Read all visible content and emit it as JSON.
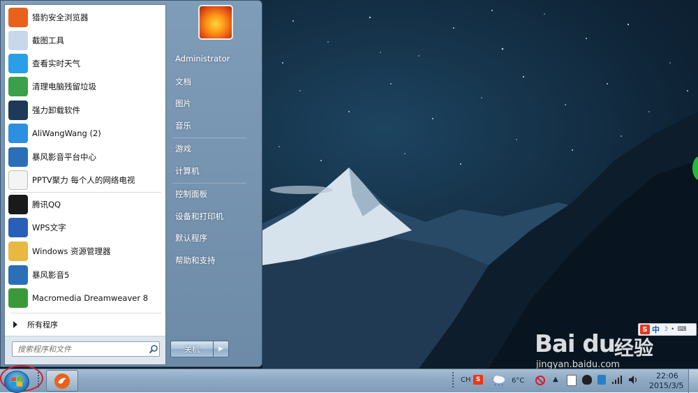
{
  "start_menu": {
    "programs": [
      {
        "label": "猎豹安全浏览器",
        "icon": "cheetah-browser-icon",
        "color": "#e8621a"
      },
      {
        "label": "截图工具",
        "icon": "scissors-icon",
        "color": "#c8d8ea"
      },
      {
        "label": "查看实时天气",
        "icon": "weather-cloud-icon",
        "color": "#2a9ee8"
      },
      {
        "label": "清理电脑残留垃圾",
        "icon": "recycle-bin-icon",
        "color": "#3aa04a"
      },
      {
        "label": "强力卸载软件",
        "icon": "uninstall-shield-icon",
        "color": "#1e3a58"
      },
      {
        "label": "AliWangWang (2)",
        "icon": "aliwangwang-icon",
        "color": "#2c8fe0"
      },
      {
        "label": "暴风影音平台中心",
        "icon": "film-icon",
        "color": "#2a6fb8"
      },
      {
        "label": "PPTV聚力 每个人的网络电视",
        "icon": "blank-file-icon",
        "color": "#f4f4f4"
      },
      {
        "label": "腾讯QQ",
        "icon": "qq-penguin-icon",
        "color": "#1a1a1a"
      },
      {
        "label": "WPS文字",
        "icon": "wps-writer-icon",
        "color": "#2a5fb8"
      },
      {
        "label": "Windows 资源管理器",
        "icon": "explorer-folder-icon",
        "color": "#e8b840"
      },
      {
        "label": "暴风影音5",
        "icon": "film-icon",
        "color": "#2a6fb8"
      },
      {
        "label": "Macromedia Dreamweaver 8",
        "icon": "dreamweaver-icon",
        "color": "#3a9a3a"
      }
    ],
    "all_programs": "所有程序",
    "search_placeholder": "搜索程序和文件",
    "right": {
      "user": "Administrator",
      "documents": "文档",
      "pictures": "图片",
      "music": "音乐",
      "games": "游戏",
      "computer": "计算机",
      "control_panel": "控制面板",
      "devices_printers": "设备和打印机",
      "default_programs": "默认程序",
      "help_support": "帮助和支持"
    },
    "shutdown_label": "关机"
  },
  "taskbar": {
    "ime_lang": "CH",
    "temperature": "6°C",
    "time": "22:06",
    "date": "2015/3/5"
  },
  "ime_bar": {
    "logo": "S",
    "mode": "中"
  },
  "watermark": {
    "logo": "Bai du",
    "cn": "经验",
    "url": "jingyan.baidu.com"
  },
  "colors": {
    "accent_red": "#d41e2a",
    "menu_frame": "#7f9cb8"
  }
}
